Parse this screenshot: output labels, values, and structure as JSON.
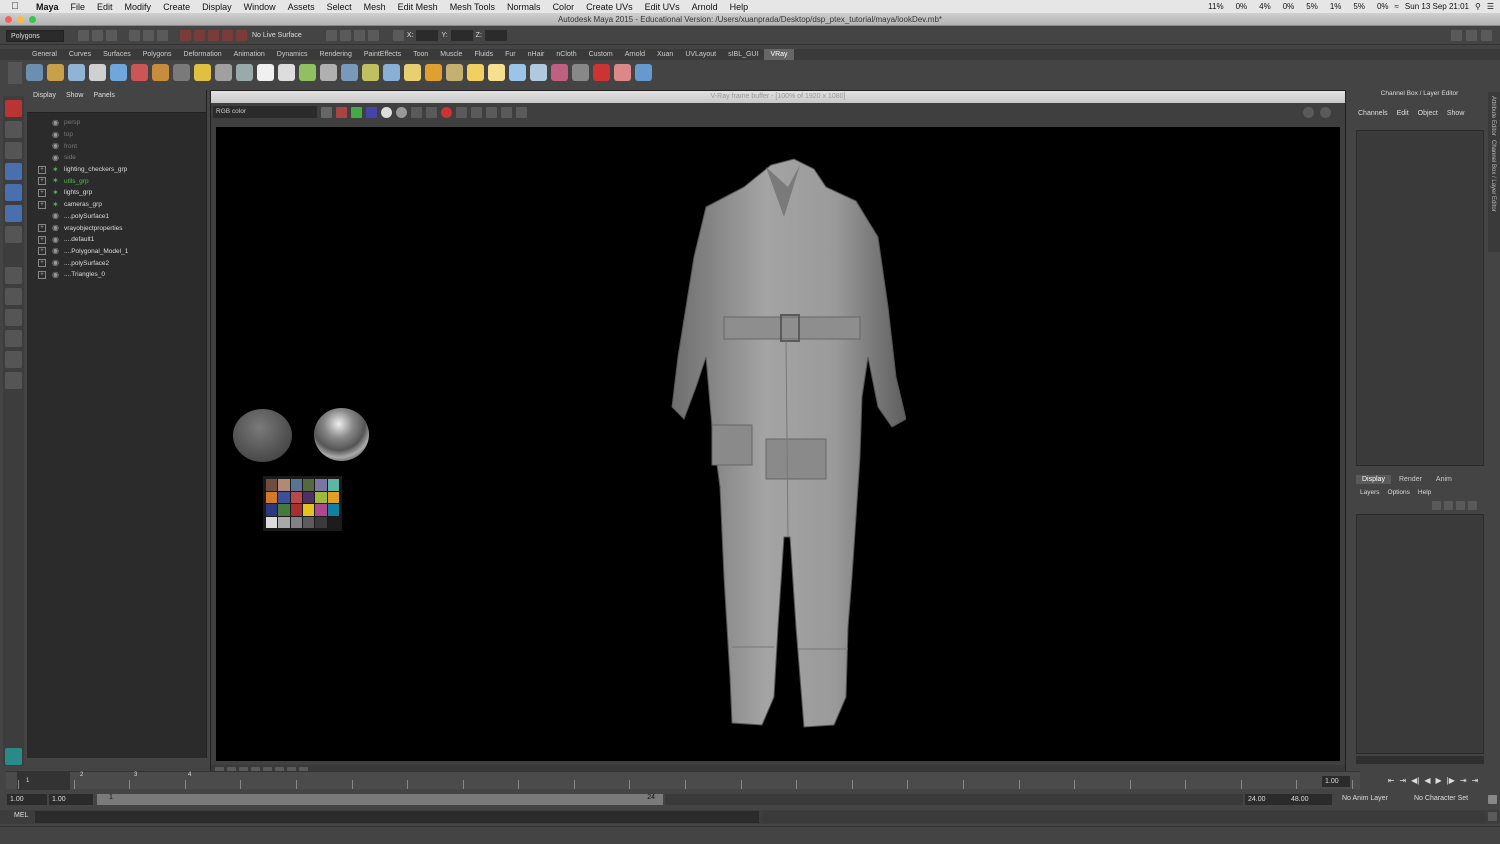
{
  "mac_menu": {
    "app": "Maya",
    "items": [
      "File",
      "Edit",
      "Modify",
      "Create",
      "Display",
      "Window",
      "Assets",
      "Select",
      "Mesh",
      "Edit Mesh",
      "Mesh Tools",
      "Normals",
      "Color",
      "Create UVs",
      "Edit UVs",
      "Arnold",
      "Help"
    ],
    "status": [
      "11%",
      "0%",
      "4%",
      "0%",
      "5%",
      "1%",
      "5%",
      "0%"
    ],
    "clock": "Sun 13 Sep  21:01"
  },
  "window_title": "Autodesk Maya 2015 - Educational Version: /Users/xuanprada/Desktop/dsp_ptex_tutorial/maya/lookDev.mb*",
  "status_line": {
    "menu_set": "Polygons",
    "live_surface": "No Live Surface",
    "x_label": "X:",
    "y_label": "Y:",
    "z_label": "Z:"
  },
  "shelf_tabs": [
    "General",
    "Curves",
    "Surfaces",
    "Polygons",
    "Deformation",
    "Animation",
    "Dynamics",
    "Rendering",
    "PaintEffects",
    "Toon",
    "Muscle",
    "Fluids",
    "Fur",
    "nHair",
    "nCloth",
    "Custom",
    "Arnold",
    "Xuan",
    "UVLayout",
    "sIBL_GUI",
    "VRay"
  ],
  "active_shelf": "VRay",
  "shelf_icon_colors": [
    "#6a8fb0",
    "#c9a04a",
    "#8fb4d6",
    "#d0d0d0",
    "#6fa7dd",
    "#cc5555",
    "#c78d3c",
    "#7a7a7a",
    "#e0c040",
    "#a0a0a0",
    "#9aa",
    "#f0f0f0",
    "#dddddd",
    "#90c060",
    "#b0b0b0",
    "#7799bb",
    "#c0c060",
    "#8ab0d8",
    "#e6d070",
    "#e0a030",
    "#c6b070",
    "#f0d060",
    "#f6e090",
    "#9bc4e8",
    "#b0c8e0",
    "#c06080",
    "#888888",
    "#cc3333",
    "#dd8888",
    "#6699cc"
  ],
  "outliner": {
    "menu": [
      "Display",
      "Show",
      "Panels"
    ],
    "items": [
      {
        "label": "persp",
        "style": "dim",
        "expand": false
      },
      {
        "label": "top",
        "style": "dim",
        "expand": false
      },
      {
        "label": "front",
        "style": "dim",
        "expand": false
      },
      {
        "label": "side",
        "style": "dim",
        "expand": false
      },
      {
        "label": "lighting_checkers_grp",
        "style": "normal",
        "expand": true
      },
      {
        "label": "utils_grp",
        "style": "green",
        "expand": true
      },
      {
        "label": "lights_grp",
        "style": "normal",
        "expand": true
      },
      {
        "label": "cameras_grp",
        "style": "normal",
        "expand": true
      },
      {
        "label": "....polySurface1",
        "style": "normal",
        "expand": false
      },
      {
        "label": "vrayobjectproperties",
        "style": "normal",
        "expand": true
      },
      {
        "label": "....default1",
        "style": "normal",
        "expand": true
      },
      {
        "label": "....Polygonal_Model_1",
        "style": "normal",
        "expand": true
      },
      {
        "label": "....polySurface2",
        "style": "normal",
        "expand": true
      },
      {
        "label": "....Triangles_0",
        "style": "normal",
        "expand": true
      }
    ]
  },
  "vfb": {
    "title": "V-Ray frame buffer - [100% of 1920 x 1080]",
    "channel": "RGB color",
    "color_checker": [
      "#6e4d3e",
      "#b08a76",
      "#5b7393",
      "#556a3c",
      "#7a75a6",
      "#5fb5a4",
      "#d17a2a",
      "#3e4f99",
      "#b9474e",
      "#4f2f66",
      "#9db83a",
      "#e1a023",
      "#2d3780",
      "#467a3c",
      "#a62f2f",
      "#e5c21c",
      "#b0468e",
      "#0e81a0",
      "#dcdcdc",
      "#a8a8a8",
      "#828282",
      "#5c5c5c",
      "#3a3a3a",
      "#1c1c1c"
    ]
  },
  "channel_box": {
    "title": "Channel Box / Layer Editor",
    "menus": [
      "Channels",
      "Edit",
      "Object",
      "Show"
    ],
    "layer_tabs": [
      "Display",
      "Render",
      "Anim"
    ],
    "active_layer_tab": "Display",
    "layer_menus": [
      "Layers",
      "Options",
      "Help"
    ]
  },
  "side_tabs": [
    "Attribute Editor",
    "Channel Box / Layer Editor"
  ],
  "time_slider": {
    "ticks": [
      "1",
      "2",
      "3",
      "4"
    ],
    "current": "1.00"
  },
  "range_slider": {
    "start_time": "1.00",
    "playback_start": "1.00",
    "range_start": "1",
    "range_end": "24",
    "playback_end": "24.00",
    "end_time": "48.00",
    "anim_layer": "No Anim Layer",
    "character_set": "No Character Set"
  },
  "command_line": {
    "label": "MEL"
  }
}
